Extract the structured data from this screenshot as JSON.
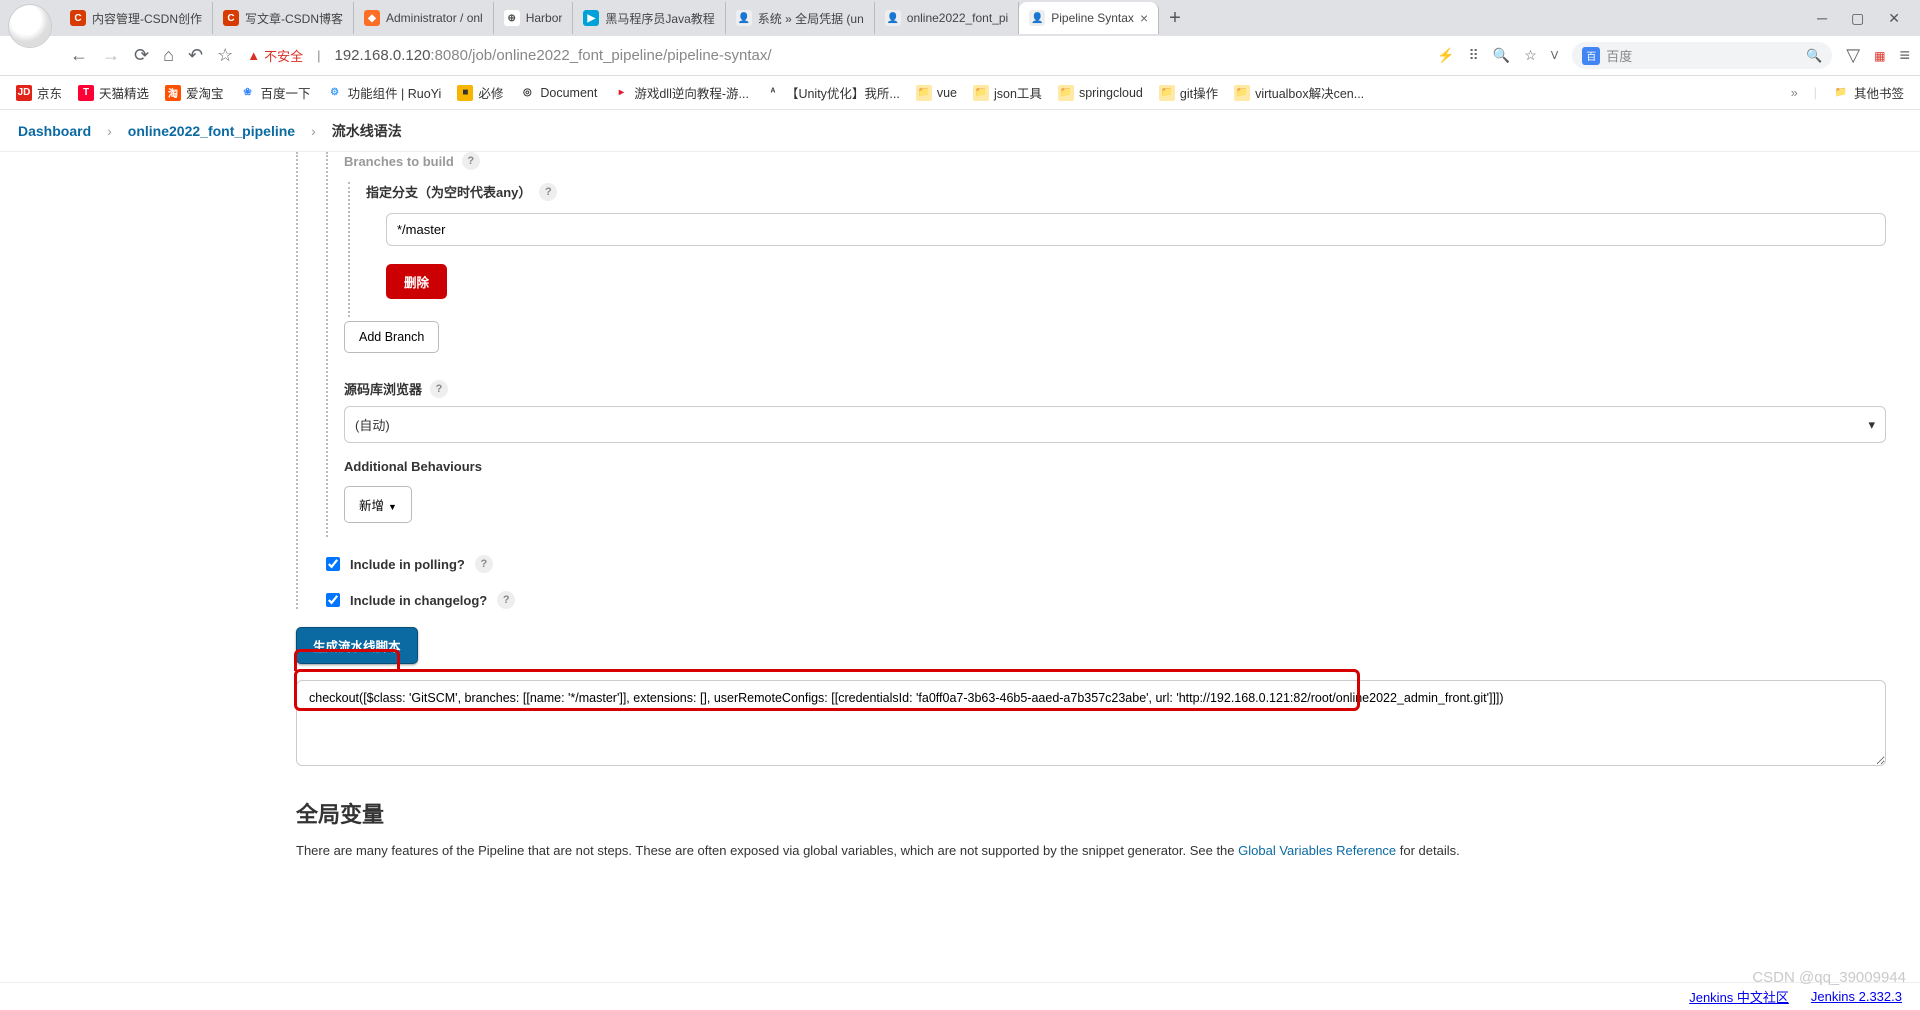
{
  "tabs": [
    {
      "favicon_bg": "#d83b01",
      "favicon_txt": "C",
      "label": "内容管理-CSDN创作"
    },
    {
      "favicon_bg": "#d83b01",
      "favicon_txt": "C",
      "label": "写文章-CSDN博客"
    },
    {
      "favicon_bg": "#fc6d26",
      "favicon_txt": "◆",
      "label": "Administrator / onl"
    },
    {
      "favicon_bg": "#fff",
      "favicon_txt": "⊕",
      "label": "Harbor"
    },
    {
      "favicon_bg": "#00a1d6",
      "favicon_txt": "▶",
      "label": "黑马程序员Java教程"
    },
    {
      "favicon_bg": "#eee",
      "favicon_txt": "👤",
      "label": "系统 » 全局凭据 (un"
    },
    {
      "favicon_bg": "#eee",
      "favicon_txt": "👤",
      "label": "online2022_font_pi"
    },
    {
      "favicon_bg": "#eee",
      "favicon_txt": "👤",
      "label": "Pipeline Syntax",
      "active": true,
      "closable": true
    }
  ],
  "address": {
    "security_warn": "不安全",
    "host": "192.168.0.120",
    "port": ":8080",
    "path": "/job/online2022_font_pipeline/pipeline-syntax/"
  },
  "searchbox": {
    "placeholder": "百度"
  },
  "bookmarks": [
    {
      "bg": "#e2231a",
      "fg": "#fff",
      "txt": "JD",
      "label": "京东"
    },
    {
      "bg": "#ff0036",
      "fg": "#fff",
      "txt": "T",
      "label": "天猫精选"
    },
    {
      "bg": "#ff5000",
      "fg": "#fff",
      "txt": "淘",
      "label": "爱淘宝"
    },
    {
      "bg": "#fff",
      "fg": "#3385ff",
      "txt": "❀",
      "label": "百度一下"
    },
    {
      "bg": "#fff",
      "fg": "#409eff",
      "txt": "⚙",
      "label": "功能组件 | RuoYi"
    },
    {
      "bg": "#f7b500",
      "fg": "#333",
      "txt": "■",
      "label": "必修"
    },
    {
      "bg": "#fff",
      "fg": "#333",
      "txt": "◎",
      "label": "Document"
    },
    {
      "bg": "#fff",
      "fg": "#e6162d",
      "txt": "▸",
      "label": "游戏dll逆向教程-游..."
    },
    {
      "bg": "#fff",
      "fg": "#333",
      "txt": "ᴬ",
      "label": "【Unity优化】我所..."
    },
    {
      "bg": "#ffe9a6",
      "fg": "#333",
      "txt": "📁",
      "label": "vue"
    },
    {
      "bg": "#ffe9a6",
      "fg": "#333",
      "txt": "📁",
      "label": "json工具"
    },
    {
      "bg": "#ffe9a6",
      "fg": "#333",
      "txt": "📁",
      "label": "springcloud"
    },
    {
      "bg": "#ffe9a6",
      "fg": "#333",
      "txt": "📁",
      "label": "git操作"
    },
    {
      "bg": "#ffe9a6",
      "fg": "#333",
      "txt": "📁",
      "label": "virtualbox解决cen..."
    }
  ],
  "bookmarks_right": {
    "bg": "#ffe9a6",
    "txt": "📁",
    "label": "其他书签"
  },
  "breadcrumb": {
    "root": "Dashboard",
    "project": "online2022_font_pipeline",
    "page": "流水线语法"
  },
  "form": {
    "branches_header": "Branches to build",
    "branch_label": "指定分支（为空时代表any）",
    "branch_value": "*/master",
    "delete_btn": "删除",
    "add_branch_btn": "Add Branch",
    "browser_label": "源码库浏览器",
    "browser_value": "(自动)",
    "behaviours_label": "Additional Behaviours",
    "add_behaviour_btn": "新增",
    "include_polling": "Include in polling?",
    "include_changelog": "Include in changelog?",
    "generate_btn": "生成流水线脚本",
    "script_output": "checkout([$class: 'GitSCM', branches: [[name: '*/master']], extensions: [], userRemoteConfigs: [[credentialsId: 'fa0ff0a7-3b63-46b5-aaed-a7b357c23abe', url: 'http://192.168.0.121:82/root/online2022_admin_front.git']]])"
  },
  "globals": {
    "heading": "全局变量",
    "text_pre": "There are many features of the Pipeline that are not steps. These are often exposed via global variables, which are not supported by the snippet generator. See the ",
    "link": "Global Variables Reference",
    "text_post": " for details."
  },
  "footer": {
    "community": "Jenkins 中文社区",
    "version": "Jenkins 2.332.3"
  },
  "watermark": "CSDN @qq_39009944"
}
